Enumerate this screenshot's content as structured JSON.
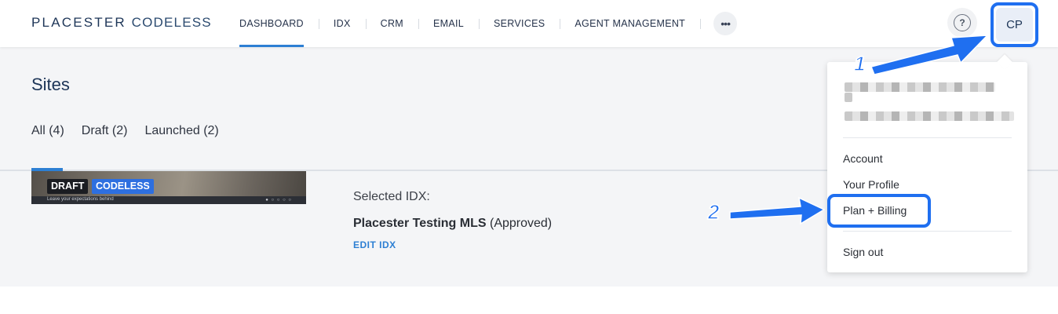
{
  "header": {
    "logo_primary": "PLACESTER",
    "logo_secondary": "CODELESS",
    "nav": [
      "DASHBOARD",
      "IDX",
      "CRM",
      "EMAIL",
      "SERVICES",
      "AGENT MANAGEMENT"
    ],
    "more_label": "•••",
    "help_label": "?",
    "avatar_initials": "CP"
  },
  "sites": {
    "title": "Sites",
    "filters": [
      "All (4)",
      "Draft (2)",
      "Launched (2)"
    ]
  },
  "site_card": {
    "badge_draft": "DRAFT",
    "badge_codeless": "CODELESS",
    "thumb_caption": "Leave your expectations behind",
    "thumb_dots": "● ○ ○ ○ ○",
    "idx_label": "Selected IDX:",
    "idx_name": "Placester Testing MLS",
    "idx_status": "(Approved)",
    "edit_idx": "EDIT IDX"
  },
  "account_menu": {
    "items": [
      "Account",
      "Your Profile",
      "Plan + Billing",
      "Sign out"
    ]
  },
  "annotations": {
    "step1": "1",
    "step2": "2"
  },
  "colors": {
    "accent": "#2d7fd3",
    "highlight": "#1f6ff0",
    "brand_navy": "#1d3557"
  }
}
